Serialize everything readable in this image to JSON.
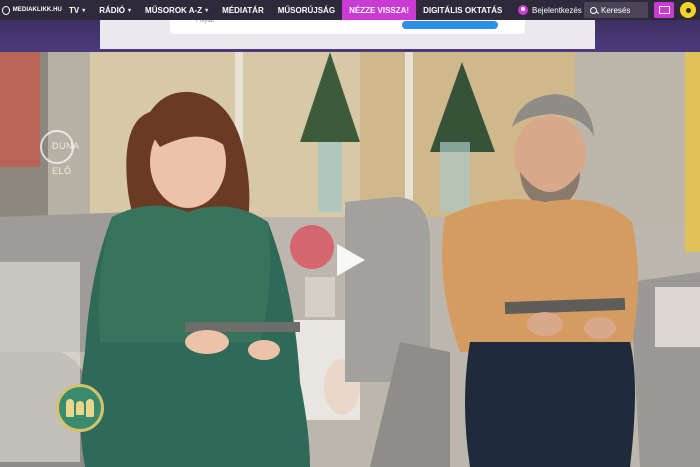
{
  "logo": {
    "text": "MEDIAKLIKK.HU"
  },
  "nav": {
    "items": [
      {
        "label": "TV",
        "caret": "▾"
      },
      {
        "label": "RÁDIÓ",
        "caret": "▾"
      },
      {
        "label": "MŰSOROK A-Z",
        "caret": "▾"
      },
      {
        "label": "MÉDIATÁR"
      },
      {
        "label": "MŰSORÚJSÁG"
      },
      {
        "label": "NÉZZE VISSZA!"
      },
      {
        "label": "DIGITÁLIS OKTATÁS"
      }
    ],
    "active_item": "NÉZZE VISSZA!"
  },
  "login": {
    "label": "Bejelentkezés",
    "icon": "user-icon"
  },
  "search": {
    "placeholder": "Keresés",
    "icon": "search-icon"
  },
  "tv_button": {
    "icon": "tv-icon"
  },
  "accessibility_button": {
    "icon": "accessibility-icon"
  },
  "dialog": {
    "faded_label": "Folytat"
  },
  "video": {
    "watermark_line1": "DUNA",
    "watermark_line2": "ELŐ",
    "play_icon": "play-icon",
    "channel_logo": "family-logo-icon"
  },
  "colors": {
    "nav_bg": "#2f2a3b",
    "accent": "#c93bd2",
    "band": "#4b3a7a",
    "accessibility_yellow": "#f1d42b"
  }
}
